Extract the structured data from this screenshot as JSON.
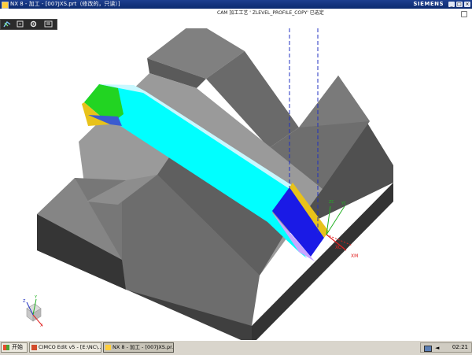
{
  "window": {
    "title": "NX 8 - 加工 - [007JXS.prt（修改的，只读）]",
    "brand": "SIEMENS",
    "minimize": "_",
    "maximize": "□",
    "close": "×"
  },
  "status": {
    "message": "CAM 加工工艺 ' ZLEVEL_PROFILE_COPY' 已选定"
  },
  "toolbar": {
    "items": [
      "wcs-icon",
      "settings-icon",
      "gear-icon",
      "list-icon"
    ]
  },
  "viewport": {
    "axes": {
      "xc": "XC",
      "xm": "XM",
      "yc": "YC",
      "zc": "ZC",
      "triad_x": "X",
      "triad_y": "Y",
      "triad_z": "Z"
    },
    "colors": {
      "background": "#ffffff",
      "part_dark": "#4a4a4a",
      "part_mid": "#7c7c7c",
      "part_light": "#9a9a9a",
      "toolpath_cyan": "#00ffff",
      "toolpath_blue": "#1a1ae6",
      "toolpath_green": "#22d422",
      "toolpath_yellow": "#e8c21a",
      "axis_red": "#e02020",
      "axis_green": "#22b022",
      "axis_blue": "#2030c0"
    }
  },
  "taskbar": {
    "start_label": "开始",
    "tasks": [
      {
        "label": "CIMCO Edit v5 - [E:\\NC\\..."
      },
      {
        "label": "NX 8 - 加工 - [007JXS.pr..."
      }
    ],
    "clock": "02:21"
  }
}
